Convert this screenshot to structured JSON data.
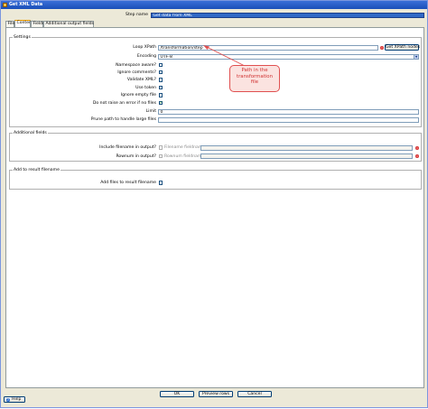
{
  "window": {
    "title": "Get XML Data"
  },
  "header": {
    "step_name_label": "Step name",
    "step_name_value": "Get data from XML"
  },
  "tabs": [
    {
      "label": "File"
    },
    {
      "label": "Content"
    },
    {
      "label": "Fields"
    },
    {
      "label": "Additional output fields"
    }
  ],
  "settings": {
    "group_label": "Settings",
    "loop_xpath": {
      "label": "Loop XPath",
      "value": "/transformation/step",
      "button": "Get XPath nodes"
    },
    "encoding": {
      "label": "Encoding",
      "value": "UTF-8"
    },
    "namespace_aware": {
      "label": "Namespace aware?",
      "checked": false
    },
    "ignore_comments": {
      "label": "Ignore comments?",
      "checked": false
    },
    "validate_xml": {
      "label": "Validate XML?",
      "checked": false
    },
    "use_token": {
      "label": "Use token",
      "checked": false
    },
    "ignore_empty_file": {
      "label": "Ignore empty file",
      "checked": false
    },
    "no_files_error": {
      "label": "Do not raise an error if no files",
      "checked": true,
      "mark": "✓"
    },
    "limit": {
      "label": "Limit",
      "value": "0"
    },
    "prune_path": {
      "label": "Prune path to handle large files",
      "value": ""
    }
  },
  "additional_fields": {
    "group_label": "Additional fields",
    "include_filename": {
      "label": "Include filename in output?",
      "field_label": "Filename fieldname"
    },
    "rownum": {
      "label": "Rownum in output?",
      "field_label": "Rownum fieldname"
    }
  },
  "result_filename": {
    "group_label": "Add to result filename",
    "add_files": {
      "label": "Add files to result filename"
    }
  },
  "annotation": {
    "line1": "Path in the",
    "line2": "transformation",
    "line3": "file"
  },
  "footer": {
    "ok": "OK",
    "preview": "Preview rows",
    "cancel": "Cancel",
    "help": "Help"
  },
  "colors": {
    "accent": "#3169c6",
    "callout_border": "#e05050",
    "callout_text": "#d03030"
  }
}
